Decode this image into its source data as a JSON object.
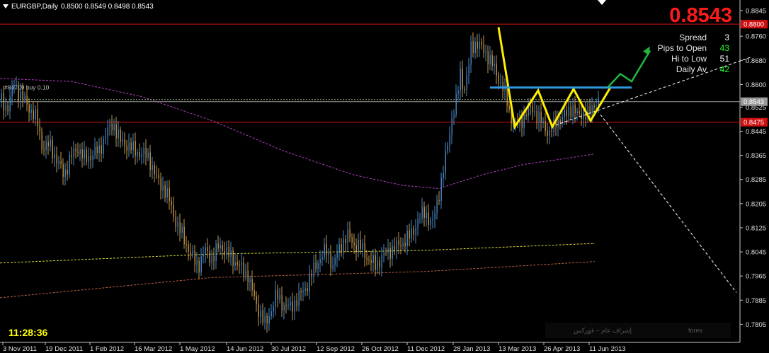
{
  "header": {
    "symbol": "EURGBP,Daily",
    "ohlc": "0.8500 0.8549 0.8498 0.8543"
  },
  "current_price_big": "0.8543",
  "info_panel": [
    {
      "label": "Spread",
      "value": "3",
      "color": "#ffffff"
    },
    {
      "label": "Pips to Open",
      "value": "43",
      "color": "#22ff22"
    },
    {
      "label": "Hi to Low",
      "value": "51",
      "color": "#ffffff"
    },
    {
      "label": "Daily Av",
      "value": "42",
      "color": "#22ff22"
    }
  ],
  "clock": "11:28:36",
  "order_label": "#84709 buy 0.10",
  "watermark": {
    "left_text": "إشراف عام – فوركس",
    "right_text": "forex"
  },
  "chart_data": {
    "type": "candlestick",
    "symbol": "EURGBP",
    "timeframe": "Daily",
    "y_ticks": [
      "0.8845",
      "0.8760",
      "0.8680",
      "0.8600",
      "0.8525",
      "0.8445",
      "0.8365",
      "0.8285",
      "0.8205",
      "0.8125",
      "0.8045",
      "0.7965",
      "0.7885",
      "0.7805"
    ],
    "x_ticks": [
      "3 Nov 2011",
      "19 Dec 2011",
      "1 Feb 2012",
      "16 Mar 2012",
      "1 May 2012",
      "14 Jun 2012",
      "30 Jul 2012",
      "12 Sep 2012",
      "26 Oct 2012",
      "11 Dec 2012",
      "28 Jan 2013",
      "13 Mar 2013",
      "26 Apr 2013",
      "11 Jun 2013"
    ],
    "ylim": [
      0.7745,
      0.888
    ],
    "price_levels": [
      {
        "value": 0.88,
        "label": "0.8800",
        "color": "#d01010"
      },
      {
        "value": 0.8543,
        "label": "0.8543",
        "color": "#9a9a9a"
      },
      {
        "value": 0.8475,
        "label": "0.8475",
        "color": "#d01010"
      }
    ],
    "close_path": [
      [
        0,
        0.855
      ],
      [
        10,
        0.852
      ],
      [
        20,
        0.86
      ],
      [
        30,
        0.856
      ],
      [
        42,
        0.852
      ],
      [
        52,
        0.848
      ],
      [
        60,
        0.839
      ],
      [
        70,
        0.84
      ],
      [
        80,
        0.835
      ],
      [
        90,
        0.83
      ],
      [
        100,
        0.836
      ],
      [
        110,
        0.839
      ],
      [
        120,
        0.835
      ],
      [
        130,
        0.837
      ],
      [
        140,
        0.838
      ],
      [
        150,
        0.844
      ],
      [
        160,
        0.847
      ],
      [
        170,
        0.841
      ],
      [
        180,
        0.84
      ],
      [
        190,
        0.838
      ],
      [
        200,
        0.837
      ],
      [
        210,
        0.836
      ],
      [
        220,
        0.829
      ],
      [
        230,
        0.826
      ],
      [
        240,
        0.821
      ],
      [
        250,
        0.813
      ],
      [
        260,
        0.809
      ],
      [
        270,
        0.803
      ],
      [
        280,
        0.8
      ],
      [
        290,
        0.805
      ],
      [
        300,
        0.802
      ],
      [
        310,
        0.807
      ],
      [
        320,
        0.804
      ],
      [
        330,
        0.802
      ],
      [
        340,
        0.799
      ],
      [
        350,
        0.797
      ],
      [
        355,
        0.792
      ],
      [
        362,
        0.787
      ],
      [
        368,
        0.784
      ],
      [
        375,
        0.78
      ],
      [
        382,
        0.785
      ],
      [
        390,
        0.79
      ],
      [
        400,
        0.787
      ],
      [
        410,
        0.786
      ],
      [
        420,
        0.789
      ],
      [
        430,
        0.792
      ],
      [
        440,
        0.797
      ],
      [
        450,
        0.802
      ],
      [
        460,
        0.805
      ],
      [
        470,
        0.8
      ],
      [
        480,
        0.806
      ],
      [
        490,
        0.81
      ],
      [
        500,
        0.807
      ],
      [
        510,
        0.806
      ],
      [
        520,
        0.802
      ],
      [
        530,
        0.8
      ],
      [
        540,
        0.803
      ],
      [
        550,
        0.805
      ],
      [
        560,
        0.806
      ],
      [
        570,
        0.808
      ],
      [
        580,
        0.81
      ],
      [
        590,
        0.815
      ],
      [
        600,
        0.818
      ],
      [
        610,
        0.813
      ],
      [
        618,
        0.822
      ],
      [
        625,
        0.83
      ],
      [
        632,
        0.84
      ],
      [
        638,
        0.849
      ],
      [
        645,
        0.855
      ],
      [
        650,
        0.864
      ],
      [
        655,
        0.858
      ],
      [
        660,
        0.863
      ],
      [
        665,
        0.872
      ],
      [
        672,
        0.874
      ],
      [
        680,
        0.872
      ],
      [
        688,
        0.87
      ],
      [
        696,
        0.866
      ],
      [
        704,
        0.862
      ],
      [
        712,
        0.858
      ],
      [
        720,
        0.85
      ],
      [
        728,
        0.846
      ],
      [
        736,
        0.848
      ],
      [
        744,
        0.851
      ],
      [
        752,
        0.852
      ],
      [
        760,
        0.849
      ],
      [
        768,
        0.846
      ],
      [
        776,
        0.844
      ],
      [
        784,
        0.847
      ],
      [
        792,
        0.849
      ],
      [
        800,
        0.85
      ],
      [
        808,
        0.853
      ],
      [
        816,
        0.849
      ],
      [
        824,
        0.851
      ],
      [
        832,
        0.85
      ],
      [
        840,
        0.854
      ],
      [
        845,
        0.8543
      ]
    ],
    "ma_slow_1": [
      [
        0,
        0.8008
      ],
      [
        300,
        0.8038
      ],
      [
        600,
        0.805
      ],
      [
        840,
        0.8073
      ]
    ],
    "ma_slow_2": [
      [
        0,
        0.7893
      ],
      [
        300,
        0.796
      ],
      [
        600,
        0.798
      ],
      [
        840,
        0.8013
      ]
    ],
    "ma_purple": [
      [
        0,
        0.862
      ],
      [
        100,
        0.861
      ],
      [
        200,
        0.856
      ],
      [
        300,
        0.848
      ],
      [
        400,
        0.838
      ],
      [
        500,
        0.83
      ],
      [
        570,
        0.8265
      ],
      [
        620,
        0.8255
      ],
      [
        680,
        0.83
      ],
      [
        740,
        0.8335
      ],
      [
        800,
        0.8355
      ],
      [
        840,
        0.837
      ]
    ],
    "pattern_zigzag_yellow": [
      [
        704,
        0.879
      ],
      [
        727,
        0.846
      ],
      [
        760,
        0.858
      ],
      [
        780,
        0.846
      ],
      [
        810,
        0.8585
      ],
      [
        834,
        0.848
      ],
      [
        862,
        0.859
      ]
    ],
    "neckline_blue": [
      [
        692,
        0.859
      ],
      [
        892,
        0.859
      ]
    ],
    "projection_green": [
      [
        858,
        0.859
      ],
      [
        876,
        0.8635
      ],
      [
        892,
        0.861
      ],
      [
        918,
        0.8712
      ]
    ],
    "trend_white_up": [
      [
        778,
        0.846
      ],
      [
        1060,
        0.869
      ]
    ],
    "trend_white_down": [
      [
        848,
        0.85
      ],
      [
        1040,
        0.791
      ]
    ],
    "ma_dotted_grey": [
      [
        0,
        0.855
      ],
      [
        845,
        0.855
      ]
    ]
  }
}
